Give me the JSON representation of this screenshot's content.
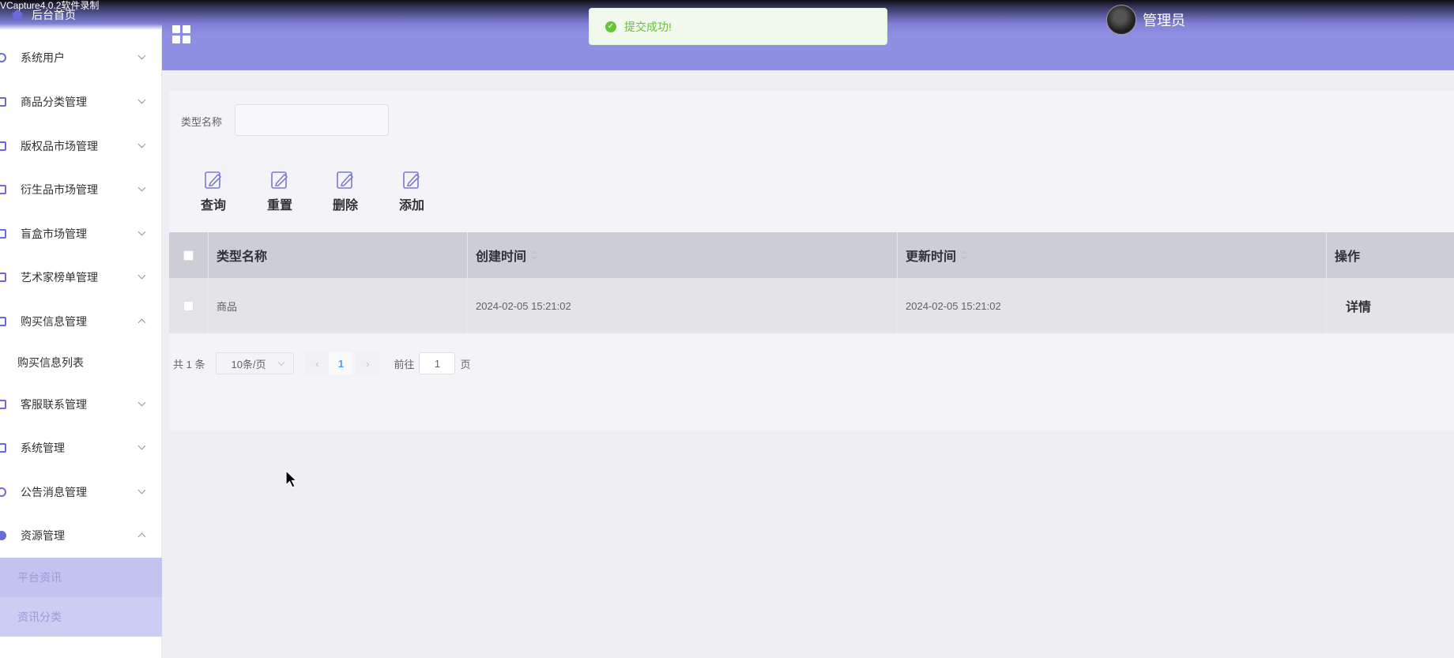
{
  "recorder_text": "VCapture4.0.2软件录制",
  "header": {
    "admin_name": "管理员"
  },
  "toast": {
    "message": "提交成功!"
  },
  "sidebar": {
    "home": "后台首页",
    "items": [
      {
        "label": "系统用户",
        "expanded": false
      },
      {
        "label": "商品分类管理",
        "expanded": false
      },
      {
        "label": "版权品市场管理",
        "expanded": false
      },
      {
        "label": "衍生品市场管理",
        "expanded": false
      },
      {
        "label": "盲盒市场管理",
        "expanded": false
      },
      {
        "label": "艺术家榜单管理",
        "expanded": false
      },
      {
        "label": "购买信息管理",
        "expanded": true
      },
      {
        "label": "购买信息列表"
      },
      {
        "label": "客服联系管理",
        "expanded": false
      },
      {
        "label": "系统管理",
        "expanded": false
      },
      {
        "label": "公告消息管理",
        "expanded": false
      },
      {
        "label": "资源管理",
        "expanded": true
      },
      {
        "label": "平台资讯"
      },
      {
        "label": "资讯分类"
      }
    ]
  },
  "search": {
    "label": "类型名称",
    "value": ""
  },
  "toolbar": {
    "query": "查询",
    "reset": "重置",
    "delete": "删除",
    "add": "添加"
  },
  "table": {
    "columns": [
      "类型名称",
      "创建时间",
      "更新时间",
      "操作"
    ],
    "rows": [
      {
        "name": "商品",
        "created": "2024-02-05 15:21:02",
        "updated": "2024-02-05 15:21:02",
        "action": "详情"
      }
    ]
  },
  "pagination": {
    "total": "共 1 条",
    "page_size": "10条/页",
    "current": "1",
    "goto_label": "前往",
    "goto_value": "1",
    "page_suffix": "页"
  },
  "colors": {
    "accent": "#8f90e3",
    "success": "#67c23a",
    "active_menu": "#c3c3f0"
  }
}
